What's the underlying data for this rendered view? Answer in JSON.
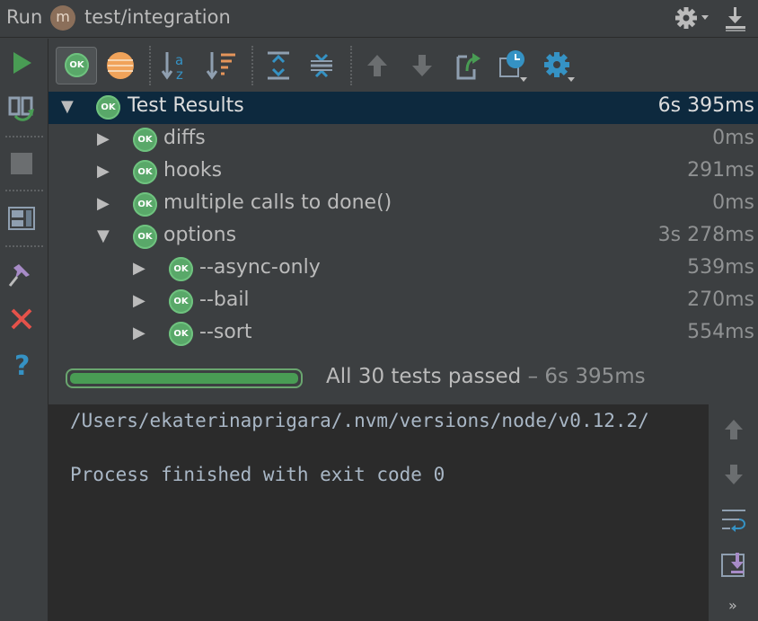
{
  "title_bar": {
    "run_label": "Run",
    "module_letter": "m",
    "config_name": "test/integration"
  },
  "icons": {
    "settings": "gear-icon",
    "pin": "download-tray-icon",
    "rerun": "play-icon",
    "rerun_failed": "rerun-failed-icon",
    "stop": "stop-icon",
    "layout": "layout-icon",
    "pin_tab": "pin-icon",
    "close": "close-icon",
    "help": "help-icon"
  },
  "toolbar": {
    "ok_badge": "OK"
  },
  "tree": {
    "root": {
      "label": "Test Results",
      "duration": "6s 395ms",
      "status": "OK"
    },
    "items": [
      {
        "label": "diffs",
        "duration": "0ms",
        "status": "OK",
        "level": 1,
        "expanded": false
      },
      {
        "label": "hooks",
        "duration": "291ms",
        "status": "OK",
        "level": 1,
        "expanded": false
      },
      {
        "label": "multiple calls to done()",
        "duration": "0ms",
        "status": "OK",
        "level": 1,
        "expanded": false
      },
      {
        "label": "options",
        "duration": "3s 278ms",
        "status": "OK",
        "level": 1,
        "expanded": true
      },
      {
        "label": "--async-only",
        "duration": "539ms",
        "status": "OK",
        "level": 2,
        "expanded": false
      },
      {
        "label": "--bail",
        "duration": "270ms",
        "status": "OK",
        "level": 2,
        "expanded": false
      },
      {
        "label": "--sort",
        "duration": "554ms",
        "status": "OK",
        "level": 2,
        "expanded": false
      }
    ]
  },
  "progress": {
    "fraction": 1.0,
    "status_text": "All 30 tests passed",
    "status_duration": "– 6s 395ms"
  },
  "console": {
    "lines": [
      "/Users/ekaterinaprigara/.nvm/versions/node/v0.12.2/",
      "",
      "Process finished with exit code 0"
    ]
  },
  "colors": {
    "ok_green": "#59a869",
    "selection": "#0d293e",
    "progress_green": "#499c54"
  }
}
